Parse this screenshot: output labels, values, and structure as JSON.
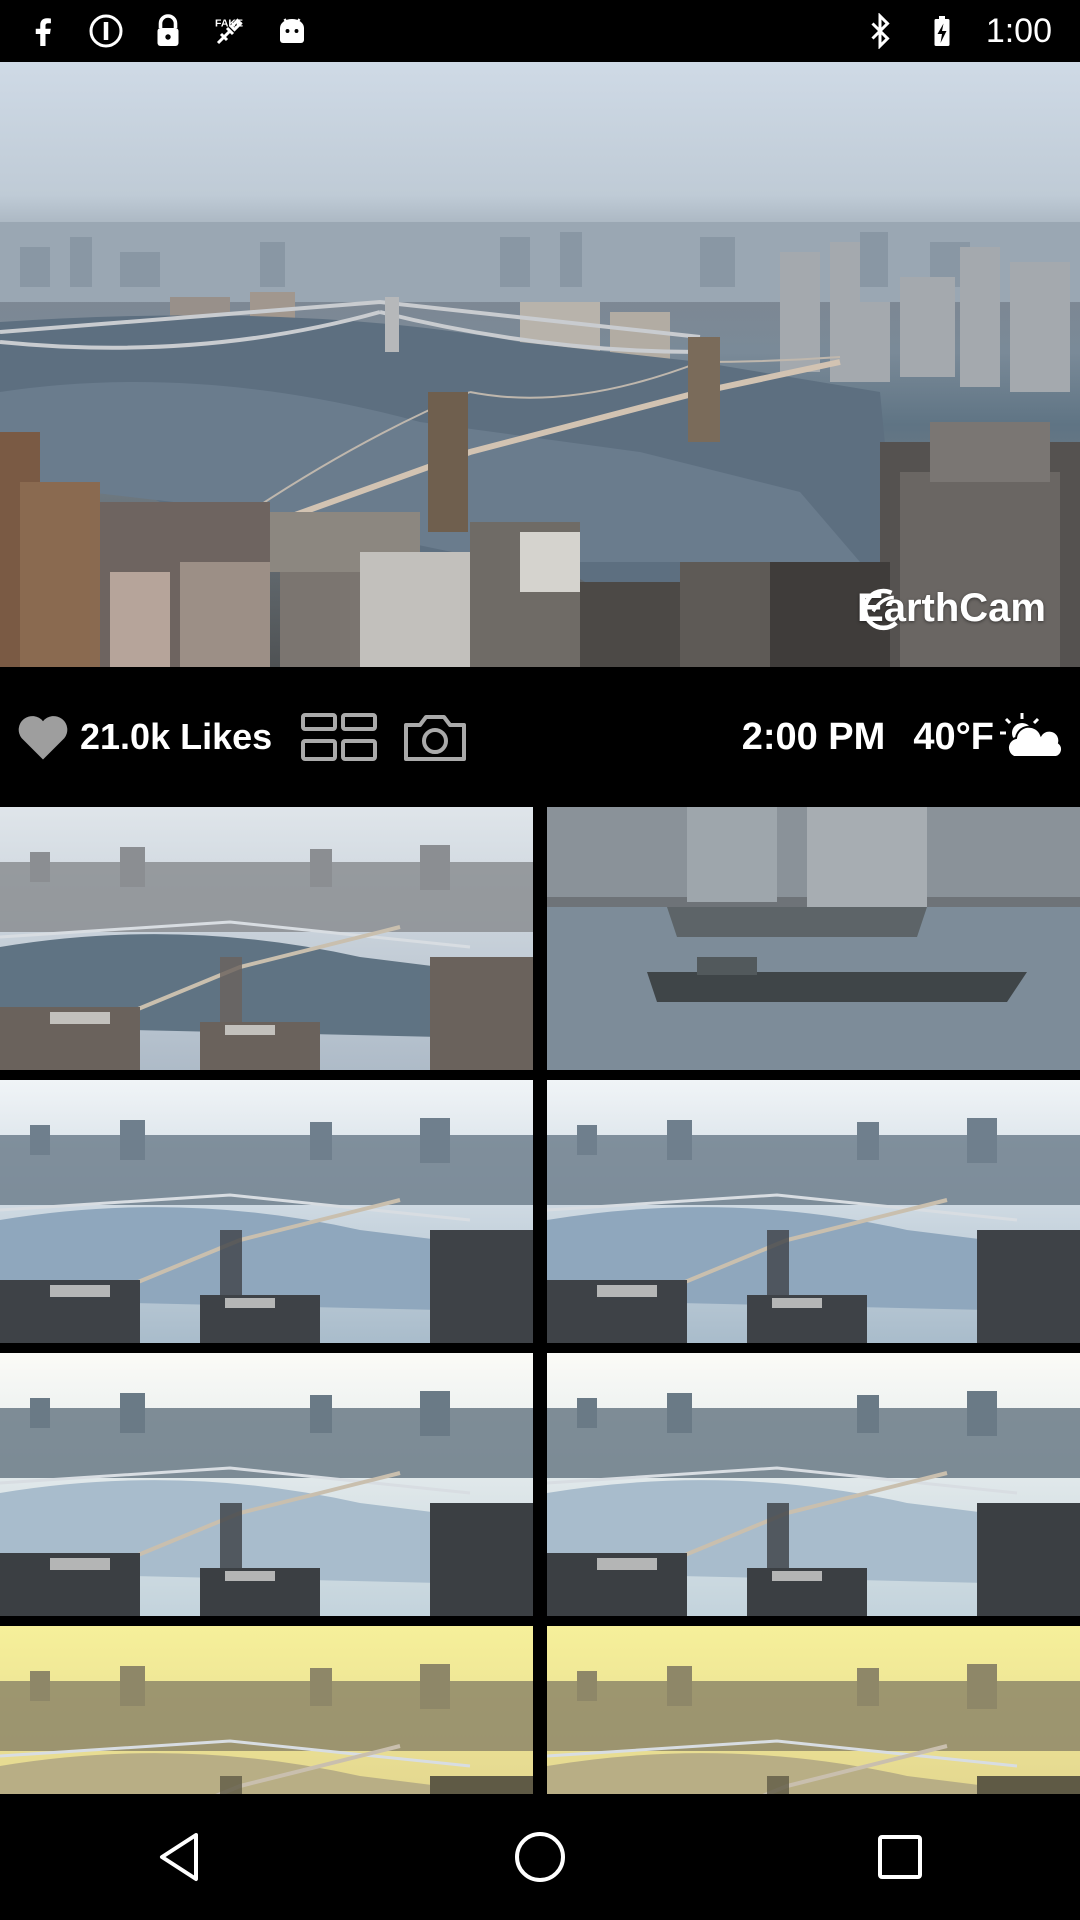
{
  "status_bar": {
    "time": "1:00",
    "left_icons": [
      "facebook-icon",
      "circle-info-icon",
      "lock-icon",
      "fake-gps-icon",
      "android-robot-icon"
    ],
    "right_icons": [
      "bluetooth-icon",
      "battery-charging-icon"
    ]
  },
  "hero": {
    "brand": "EarthCam"
  },
  "info_bar": {
    "likes": "21.0k Likes",
    "time": "2:00 PM",
    "temperature": "40°F",
    "weather_icon": "partly-cloudy-icon",
    "icons": [
      "heart-icon",
      "grid-view-icon",
      "camera-icon"
    ]
  },
  "thumbnails": [
    {
      "id": "t1",
      "tone": "day"
    },
    {
      "id": "t2",
      "tone": "closeup"
    },
    {
      "id": "t3",
      "tone": "morning"
    },
    {
      "id": "t4",
      "tone": "morning"
    },
    {
      "id": "t5",
      "tone": "bright"
    },
    {
      "id": "t6",
      "tone": "bright"
    },
    {
      "id": "t7",
      "tone": "sunrise"
    },
    {
      "id": "t8",
      "tone": "sunrise"
    }
  ],
  "nav_bar": {
    "icons": [
      "back-icon",
      "home-icon",
      "recents-icon"
    ]
  }
}
